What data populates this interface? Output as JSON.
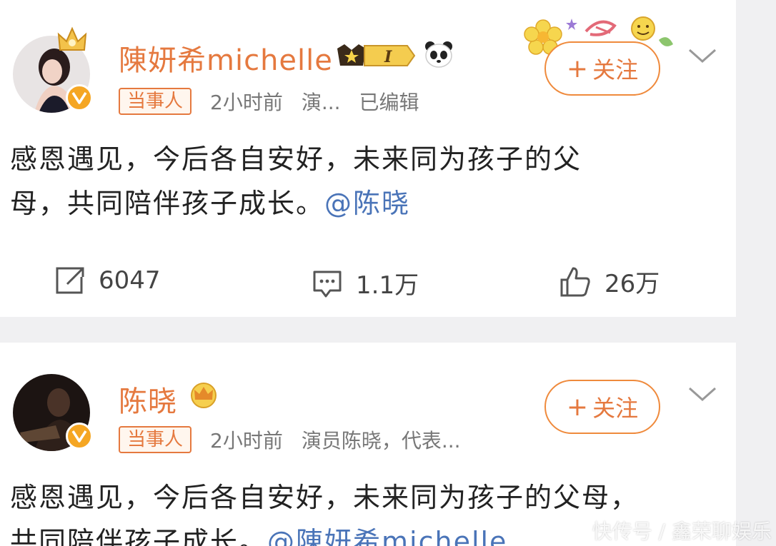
{
  "posts": [
    {
      "username": "陳妍希michelle",
      "badge": "当事人",
      "time": "2小时前",
      "bio": "演...",
      "edited": "已编辑",
      "follow_label": "关注",
      "follow_plus": "+",
      "text_line1": "感恩遇见，今后各自安好，未来同为孩子的父",
      "text_line2": "母，共同陪伴孩子成长。",
      "mention": "@陈晓",
      "actions": {
        "repost": "6047",
        "comment": "1.1万",
        "like": "26万"
      },
      "level_badge": "I"
    },
    {
      "username": "陈晓",
      "badge": "当事人",
      "time": "2小时前",
      "bio": "演员陈晓，代表...",
      "follow_label": "关注",
      "follow_plus": "+",
      "text_line1": "感恩遇见，今后各自安好，未来同为孩子的父母，",
      "text_line2": "共同陪伴孩子成长。",
      "mention": "@陳妍希michelle"
    }
  ],
  "watermark": "快传号 / 鑫荣聊娱乐",
  "colors": {
    "username": "#e5793f",
    "mention": "#4a74b8",
    "verified": "#f5a623"
  },
  "icons": [
    "verified-icon",
    "crown-icon",
    "level-badge-icon",
    "panda-icon",
    "flower-decoration-icon",
    "chevron-down-icon",
    "repost-icon",
    "comment-icon",
    "like-icon",
    "vip-crown-icon"
  ]
}
